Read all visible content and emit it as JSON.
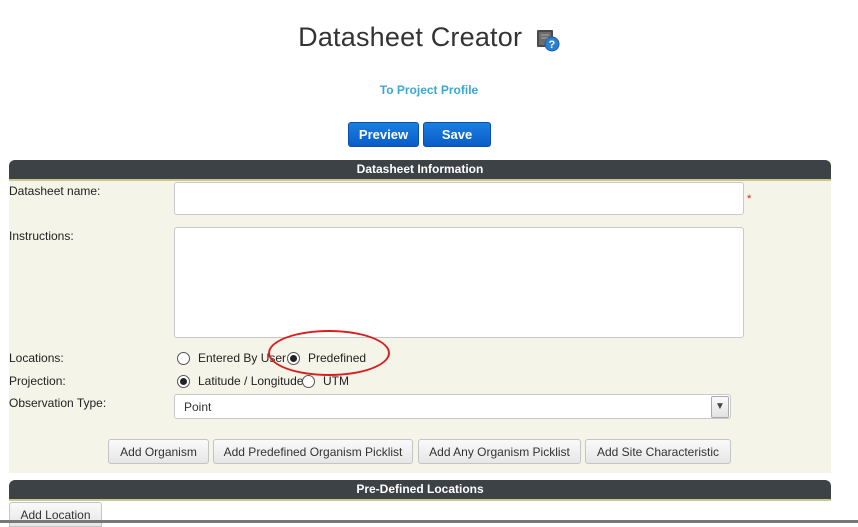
{
  "header": {
    "title": "Datasheet Creator",
    "profile_link": "To Project Profile",
    "preview_label": "Preview",
    "save_label": "Save"
  },
  "datasheet_info": {
    "section_title": "Datasheet Information",
    "name_label": "Datasheet name:",
    "name_value": "",
    "required_marker": "*",
    "instructions_label": "Instructions:",
    "instructions_value": "",
    "locations_label": "Locations:",
    "locations_options": [
      "Entered By User",
      "Predefined"
    ],
    "locations_selected": "Predefined",
    "projection_label": "Projection:",
    "projection_options": [
      "Latitude / Longitude",
      "UTM"
    ],
    "projection_selected": "Latitude / Longitude",
    "observation_type_label": "Observation Type:",
    "observation_type_value": "Point",
    "buttons": {
      "add_organism": "Add Organism",
      "add_predefined_picklist": "Add Predefined Organism Picklist",
      "add_any_picklist": "Add Any Organism Picklist",
      "add_site_characteristic": "Add Site Characteristic"
    }
  },
  "predefined_locations": {
    "section_title": "Pre-Defined Locations",
    "add_location_label": "Add Location"
  },
  "icons": {
    "help": "help-book-icon"
  },
  "colors": {
    "link": "#39a7d8",
    "primary_button": "#0a5cc8",
    "section_header": "#3d4247",
    "annotation": "#d81f1f"
  }
}
